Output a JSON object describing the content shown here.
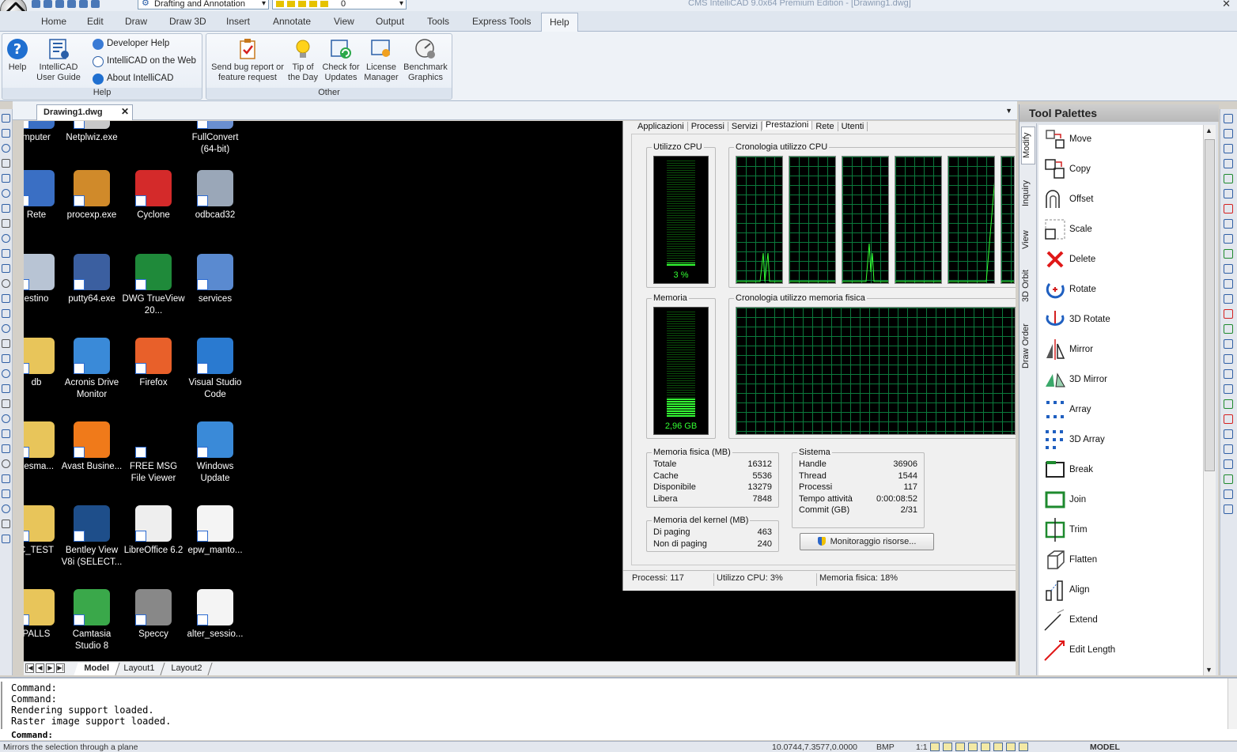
{
  "window": {
    "title": "CMS IntelliCAD 9.0x64 Premium Edition - [Drawing1.dwg]",
    "workspace": "Drafting and Annotation",
    "current_layer": "0"
  },
  "ribbon_tabs": [
    "Home",
    "Edit",
    "Draw",
    "Draw 3D",
    "Insert",
    "Annotate",
    "View",
    "Output",
    "Tools",
    "Express Tools",
    "Help"
  ],
  "ribbon": {
    "help_group": {
      "label": "Help",
      "help_label": "Help",
      "user_guide_label": "IntelliCAD User Guide",
      "developer_help": "Developer Help",
      "on_the_web": "IntelliCAD on the Web",
      "about": "About IntelliCAD"
    },
    "other_group": {
      "label": "Other",
      "bug_report": "Send bug report or feature request",
      "tip_of_day": "Tip of the Day",
      "check_updates": "Check for Updates",
      "license_manager": "License Manager",
      "benchmark": "Benchmark Graphics"
    }
  },
  "document_tab": {
    "label": "Drawing1.dwg",
    "close": "✕"
  },
  "desktop_icons": [
    {
      "label": "mputer",
      "color": "#3a6fc4"
    },
    {
      "label": "Netplwiz.exe",
      "color": "#c8c8c8"
    },
    {
      "label": "FullConvert (64-bit)",
      "color": "#6a8fd0"
    },
    {
      "label": "Rete",
      "color": "#3a6fc4"
    },
    {
      "label": "procexp.exe",
      "color": "#d08a2a"
    },
    {
      "label": "Cyclone",
      "color": "#d42a2a"
    },
    {
      "label": "odbcad32",
      "color": "#9aa7b8"
    },
    {
      "label": "estino",
      "color": "#b8c4d4"
    },
    {
      "label": "putty64.exe",
      "color": "#3b5fa0"
    },
    {
      "label": "DWG TrueView 20...",
      "color": "#1f8a3a"
    },
    {
      "label": "services",
      "color": "#5a8ad0"
    },
    {
      "label": "db",
      "color": "#e8c55a"
    },
    {
      "label": "Acronis Drive Monitor",
      "color": "#3a8ad8"
    },
    {
      "label": "Firefox",
      "color": "#e8602a"
    },
    {
      "label": "Visual Studio Code",
      "color": "#2a7ad0"
    },
    {
      "label": "pesma...",
      "color": "#e8c55a"
    },
    {
      "label": "Avast Busine...",
      "color": "#f07a1a"
    },
    {
      "label": "FREE MSG File Viewer",
      "color": "#000000"
    },
    {
      "label": "Windows Update",
      "color": "#3a8ad8"
    },
    {
      "label": "C_TEST",
      "color": "#e8c55a"
    },
    {
      "label": "Bentley View V8i (SELECT...",
      "color": "#1e4e8a"
    },
    {
      "label": "LibreOffice 6.2",
      "color": "#eeeeee"
    },
    {
      "label": "epw_manto...",
      "color": "#f4f4f4"
    },
    {
      "label": "PALLS",
      "color": "#e8c55a"
    },
    {
      "label": "Camtasia Studio 8",
      "color": "#3aa84a"
    },
    {
      "label": "Speccy",
      "color": "#888888"
    },
    {
      "label": "alter_sessio...",
      "color": "#f4f4f4"
    }
  ],
  "task_manager": {
    "tabs": [
      "Applicazioni",
      "Processi",
      "Servizi",
      "Prestazioni",
      "Rete",
      "Utenti"
    ],
    "cpu_usage_label": "Utilizzo CPU",
    "cpu_usage_value": "3 %",
    "cpu_usage_fraction": 0.03,
    "cpu_history_label": "Cronologia utilizzo CPU",
    "memory_label": "Memoria",
    "memory_value": "2,96 GB",
    "memory_fraction": 0.18,
    "memory_history_label": "Cronologia utilizzo memoria fisica",
    "physical_memory": {
      "label": "Memoria fisica (MB)",
      "rows": [
        {
          "k": "Totale",
          "v": "16312"
        },
        {
          "k": "Cache",
          "v": "5536"
        },
        {
          "k": "Disponibile",
          "v": "13279"
        },
        {
          "k": "Libera",
          "v": "7848"
        }
      ]
    },
    "kernel_memory": {
      "label": "Memoria del kernel (MB)",
      "rows": [
        {
          "k": "Di paging",
          "v": "463"
        },
        {
          "k": "Non di paging",
          "v": "240"
        }
      ]
    },
    "system": {
      "label": "Sistema",
      "rows": [
        {
          "k": "Handle",
          "v": "36906"
        },
        {
          "k": "Thread",
          "v": "1544"
        },
        {
          "k": "Processi",
          "v": "117"
        },
        {
          "k": "Tempo attività",
          "v": "0:00:08:52"
        },
        {
          "k": "Commit (GB)",
          "v": "2/31"
        }
      ]
    },
    "resource_monitor_button": "Monitoraggio risorse...",
    "status": {
      "processes": "Processi: 117",
      "cpu": "Utilizzo CPU: 3%",
      "memory": "Memoria fisica: 18%"
    }
  },
  "layout_tabs": [
    "Model",
    "Layout1",
    "Layout2"
  ],
  "tool_palettes": {
    "title": "Tool Palettes",
    "vertical_tabs": [
      "Modify",
      "Inquiry",
      "View",
      "3D Orbit",
      "Draw Order"
    ],
    "items": [
      {
        "label": "Move",
        "icon": "move-icon"
      },
      {
        "label": "Copy",
        "icon": "copy-icon"
      },
      {
        "label": "Offset",
        "icon": "offset-icon"
      },
      {
        "label": "Scale",
        "icon": "scale-icon"
      },
      {
        "label": "Delete",
        "icon": "delete-icon"
      },
      {
        "label": "Rotate",
        "icon": "rotate-icon"
      },
      {
        "label": "3D Rotate",
        "icon": "rotate-3d-icon"
      },
      {
        "label": "Mirror",
        "icon": "mirror-icon"
      },
      {
        "label": "3D Mirror",
        "icon": "mirror-3d-icon"
      },
      {
        "label": "Array",
        "icon": "array-icon"
      },
      {
        "label": "3D Array",
        "icon": "array-3d-icon"
      },
      {
        "label": "Break",
        "icon": "break-icon"
      },
      {
        "label": "Join",
        "icon": "join-icon"
      },
      {
        "label": "Trim",
        "icon": "trim-icon"
      },
      {
        "label": "Flatten",
        "icon": "flatten-icon"
      },
      {
        "label": "Align",
        "icon": "align-icon"
      },
      {
        "label": "Extend",
        "icon": "extend-icon"
      },
      {
        "label": "Edit Length",
        "icon": "edit-length-icon"
      }
    ]
  },
  "command_area": {
    "history": [
      "Command:",
      "Command:",
      "Rendering support loaded.",
      "Raster image support loaded."
    ],
    "prompt": "Command:"
  },
  "statusbar": {
    "hint": "Mirrors the selection through a plane",
    "coords": "10.0744,7.3577,0.0000",
    "mode": "BMP",
    "scale": "1:1",
    "space": "MODEL"
  }
}
